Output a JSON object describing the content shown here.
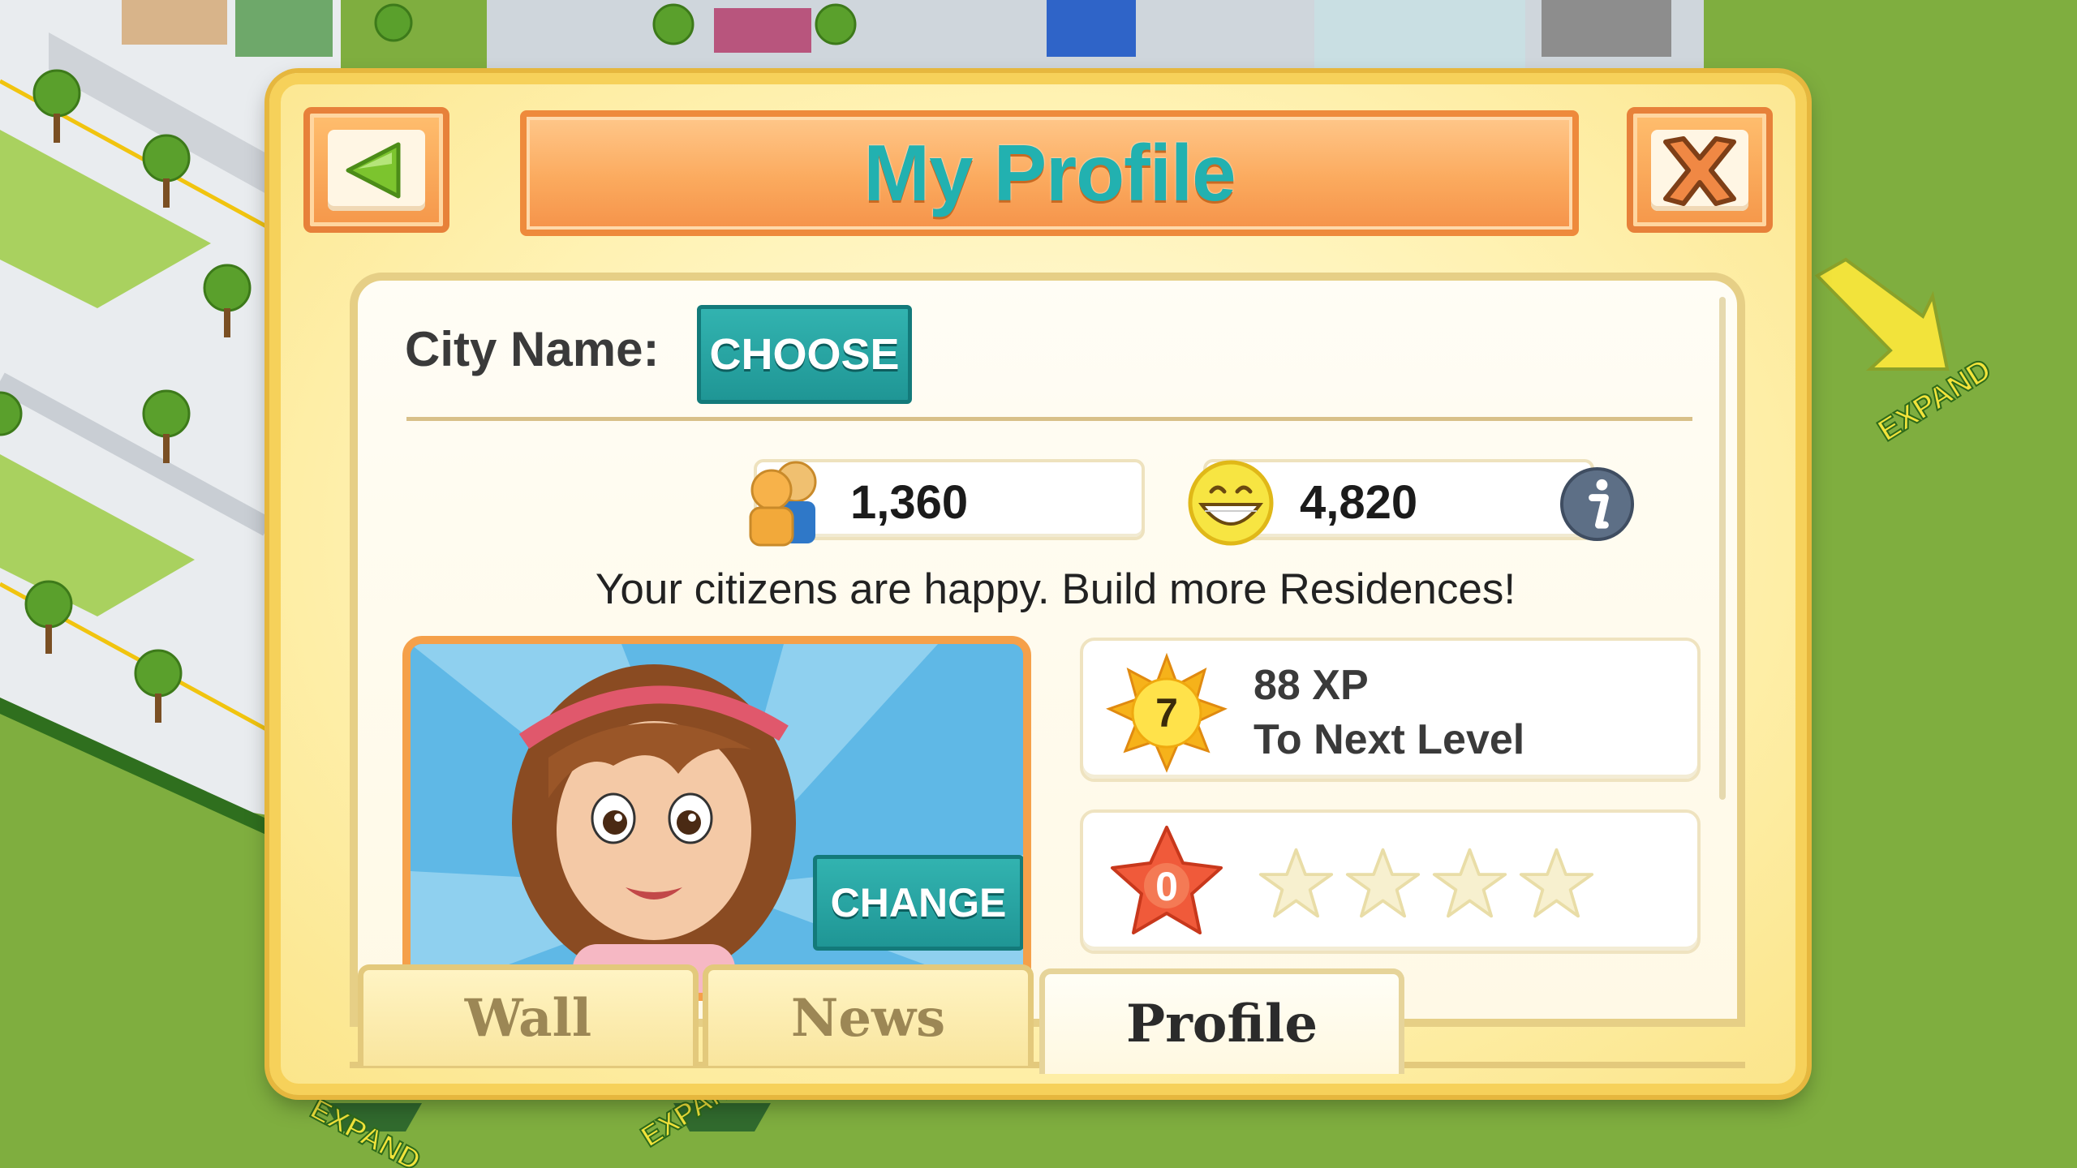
{
  "dialog": {
    "title": "My Profile"
  },
  "city": {
    "label": "City Name:",
    "choose_label": "CHOOSE"
  },
  "stats": {
    "population": "1,360",
    "happiness": "4,820",
    "message": "Your citizens are happy. Build more Residences!"
  },
  "avatar": {
    "change_label": "CHANGE"
  },
  "level": {
    "number": "7",
    "xp_text": "88 XP",
    "next_text": "To Next Level"
  },
  "rank": {
    "number": "0",
    "stars_filled": 0,
    "stars_total": 4
  },
  "tabs": [
    {
      "label": "Wall",
      "active": false
    },
    {
      "label": "News",
      "active": false
    },
    {
      "label": "Profile",
      "active": true
    }
  ],
  "background": {
    "expand_labels": [
      "EXPAND",
      "EXPAND",
      "EXPAND"
    ]
  },
  "colors": {
    "accent_teal": "#22b1b0",
    "title_orange": "#f5974a",
    "panel_yellow": "#fff2b3",
    "grass": "#7fae3f"
  },
  "icons": {
    "back": "back-arrow-icon",
    "close": "close-x-icon",
    "population": "citizens-icon",
    "happiness": "smiley-icon",
    "info": "info-icon",
    "level": "sun-level-icon",
    "rank": "rank-star-icon"
  }
}
